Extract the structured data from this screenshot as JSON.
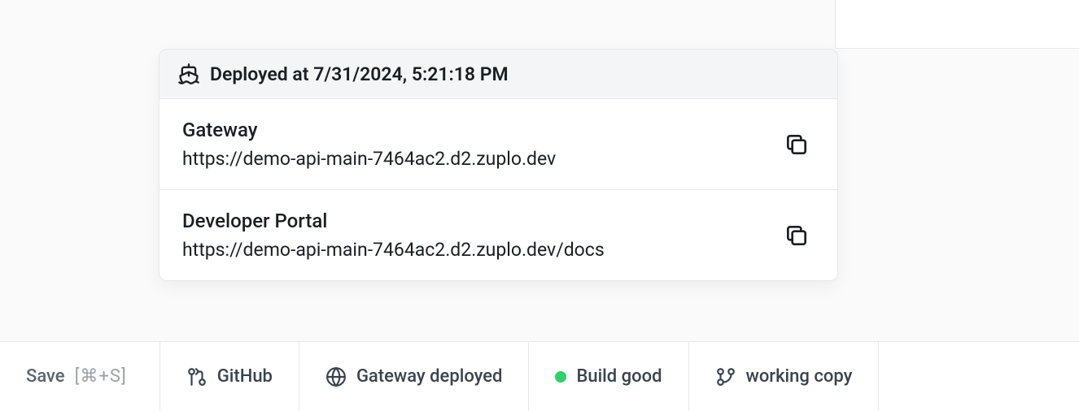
{
  "popover": {
    "header": "Deployed at 7/31/2024, 5:21:18 PM",
    "items": [
      {
        "label": "Gateway",
        "url": "https://demo-api-main-7464ac2.d2.zuplo.dev"
      },
      {
        "label": "Developer Portal",
        "url": "https://demo-api-main-7464ac2.d2.zuplo.dev/docs"
      }
    ]
  },
  "statusbar": {
    "save_label": "Save",
    "save_shortcut": "[⌘+S]",
    "github_label": "GitHub",
    "gateway_label": "Gateway deployed",
    "build_label": "Build good",
    "branch_label": "working copy"
  }
}
